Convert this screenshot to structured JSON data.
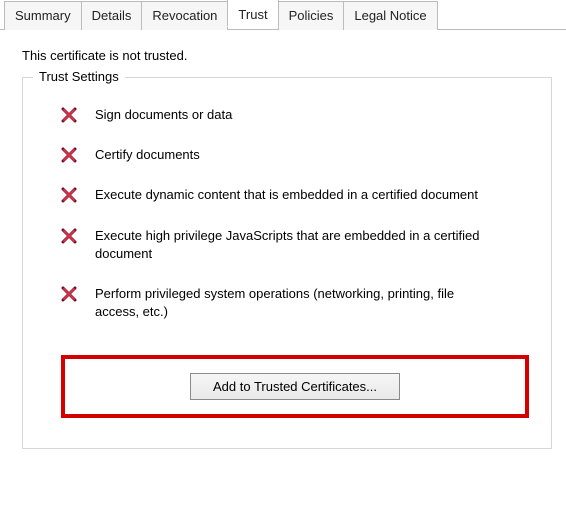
{
  "tabs": {
    "summary": "Summary",
    "details": "Details",
    "revocation": "Revocation",
    "trust": "Trust",
    "policies": "Policies",
    "legal": "Legal Notice"
  },
  "status_text": "This certificate is not trusted.",
  "group_label": "Trust Settings",
  "settings": {
    "s1": "Sign documents or data",
    "s2": "Certify documents",
    "s3": "Execute dynamic content that is embedded in a certified document",
    "s4": "Execute high privilege JavaScripts that are embedded in a certified document",
    "s5": "Perform privileged system operations (networking, printing, file access, etc.)"
  },
  "add_button_label": "Add to Trusted Certificates..."
}
